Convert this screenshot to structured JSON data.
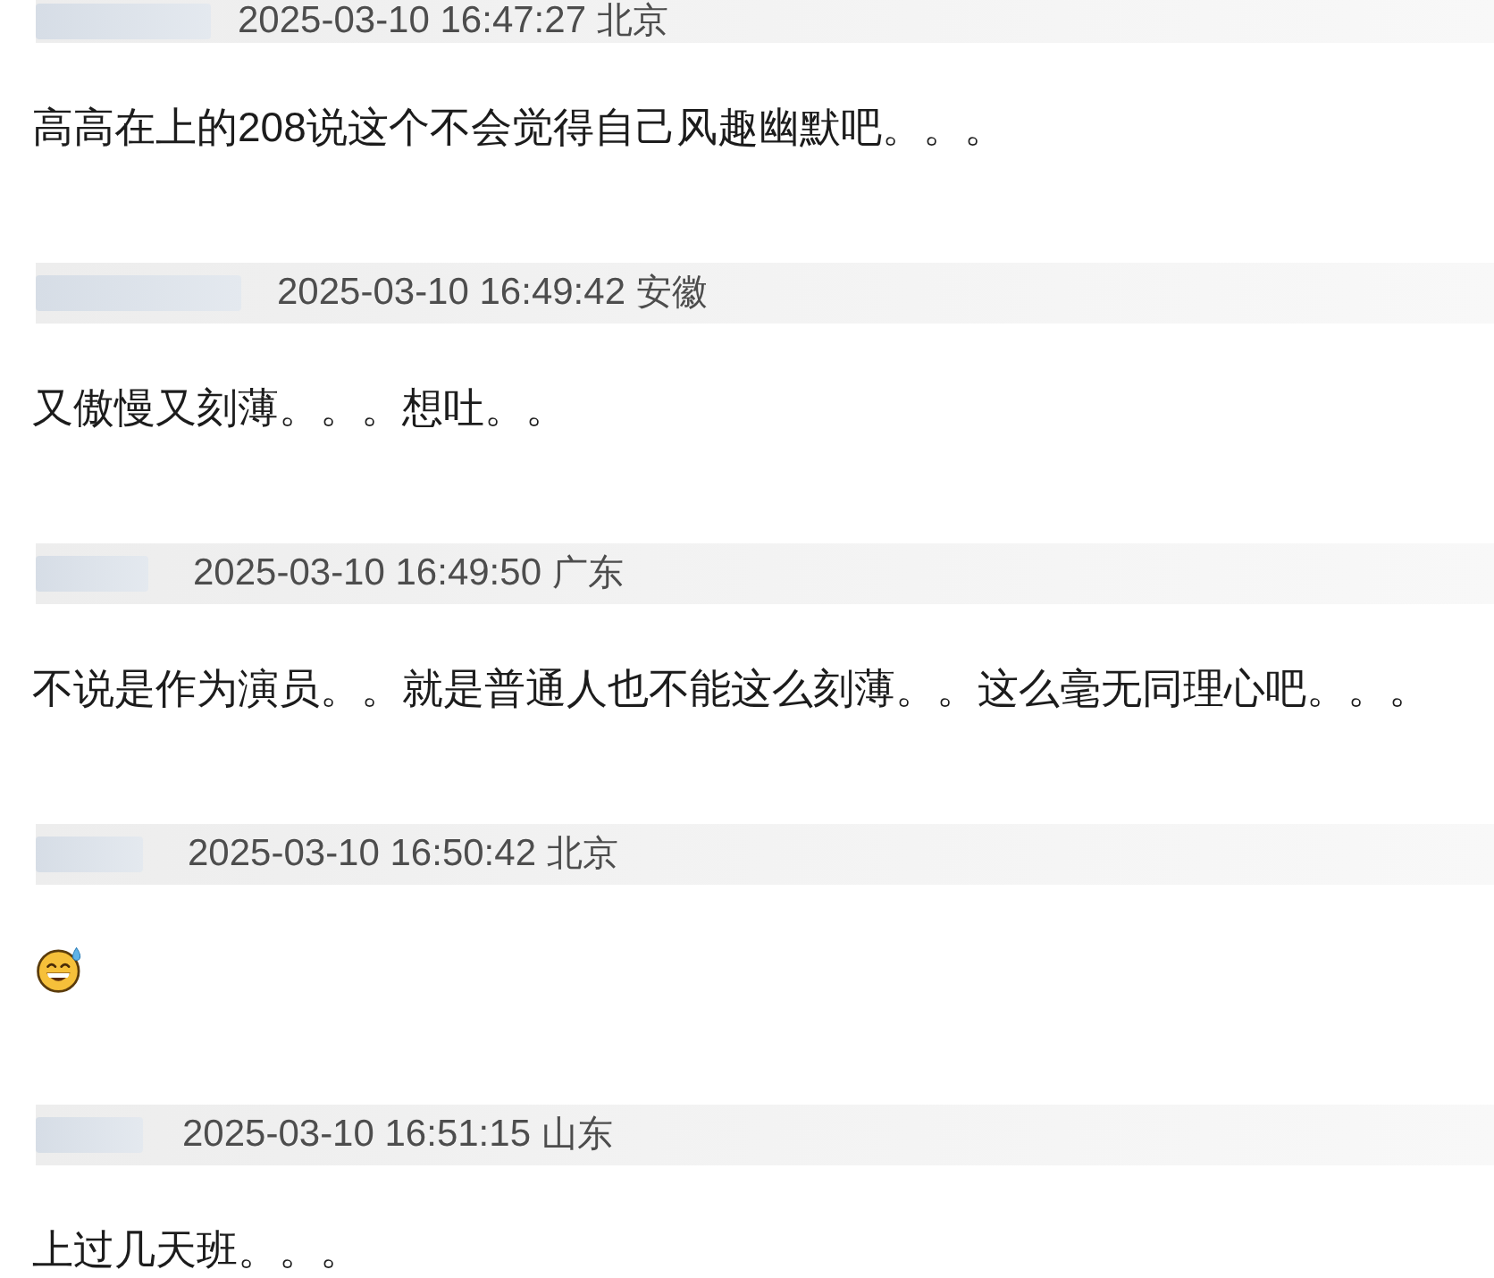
{
  "comments": [
    {
      "time": "2025-03-10 16:47:27",
      "location": "北京",
      "kind": "text",
      "text": "高高在上的208说这个不会觉得自己风趣幽默吧。。。"
    },
    {
      "time": "2025-03-10 16:49:42",
      "location": "安徽",
      "kind": "text",
      "text": "又傲慢又刻薄。。。想吐。。"
    },
    {
      "time": "2025-03-10 16:49:50",
      "location": "广东",
      "kind": "text",
      "text": "不说是作为演员。。就是普通人也不能这么刻薄。。这么毫无同理心吧。。。"
    },
    {
      "time": "2025-03-10 16:50:42",
      "location": "北京",
      "kind": "emoji"
    },
    {
      "time": "2025-03-10 16:51:15",
      "location": "山东",
      "kind": "text",
      "text": "上过几天班。。。"
    }
  ]
}
